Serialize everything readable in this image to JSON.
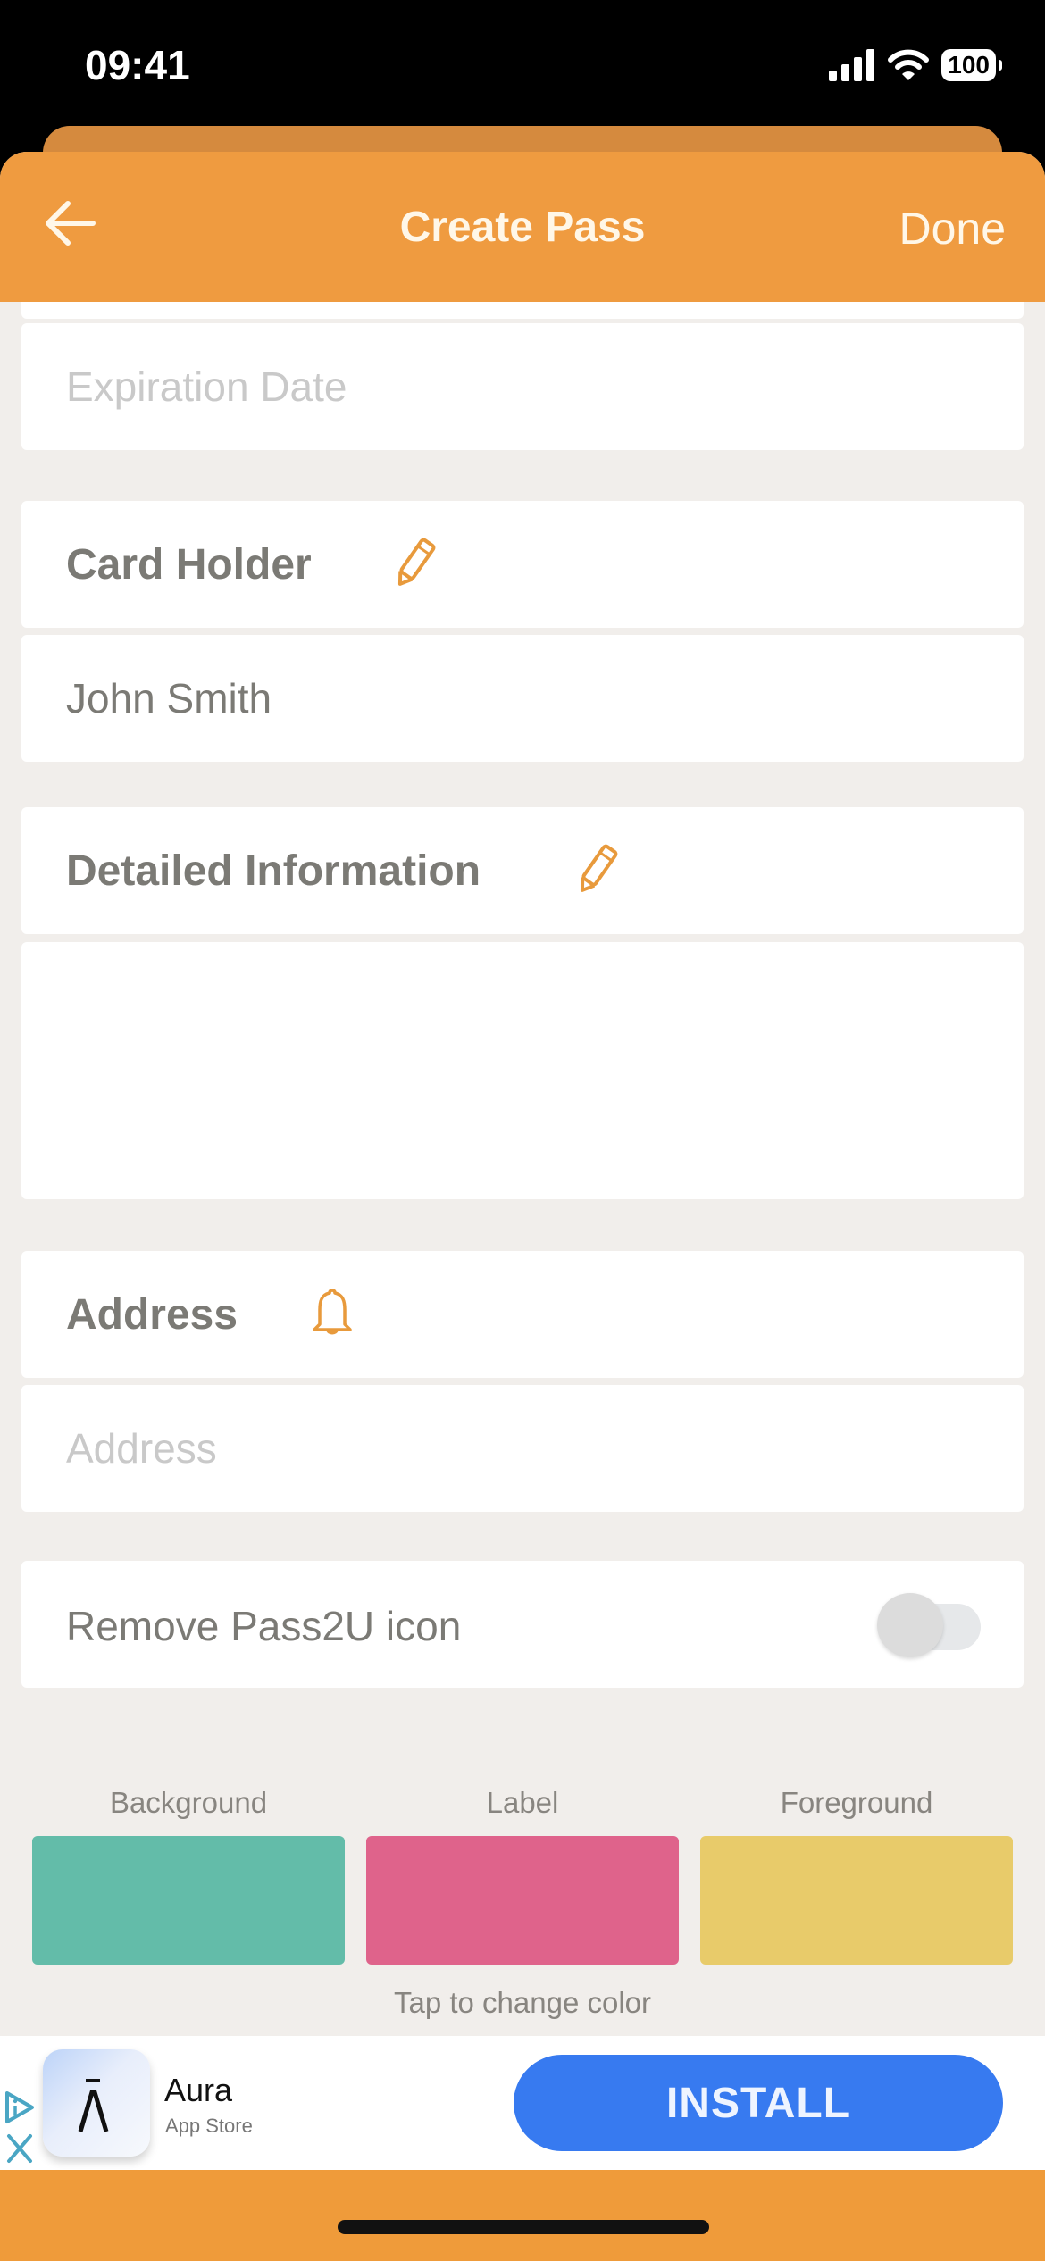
{
  "status_bar": {
    "time": "09:41",
    "battery": "100",
    "icons": [
      "signal-icon",
      "wifi-icon",
      "battery-icon"
    ]
  },
  "nav": {
    "title": "Create Pass",
    "back_icon": "arrow-left-icon",
    "done_label": "Done"
  },
  "form": {
    "expiration_date": {
      "placeholder": "Expiration Date",
      "value": ""
    },
    "card_holder": {
      "label": "Card Holder",
      "icon": "pencil-icon",
      "value": "John Smith"
    },
    "detailed_information": {
      "label": "Detailed Information",
      "icon": "pencil-icon",
      "value": ""
    },
    "address": {
      "label": "Address",
      "icon": "bell-icon",
      "placeholder": "Address",
      "value": ""
    },
    "remove_icon": {
      "label": "Remove Pass2U icon",
      "enabled": false
    }
  },
  "colors": {
    "items": [
      {
        "label": "Background",
        "hex": "#63bca9"
      },
      {
        "label": "Label",
        "hex": "#df638b"
      },
      {
        "label": "Foreground",
        "hex": "#e8cb6a"
      }
    ],
    "hint": "Tap to change color"
  },
  "ad": {
    "app_name": "Aura",
    "store": "App Store",
    "icon_glyph": "Λ",
    "install_label": "INSTALL"
  },
  "theme": {
    "accent": "#ef9b40",
    "page_bg": "#f1eeeb",
    "install_blue": "#377af0"
  }
}
